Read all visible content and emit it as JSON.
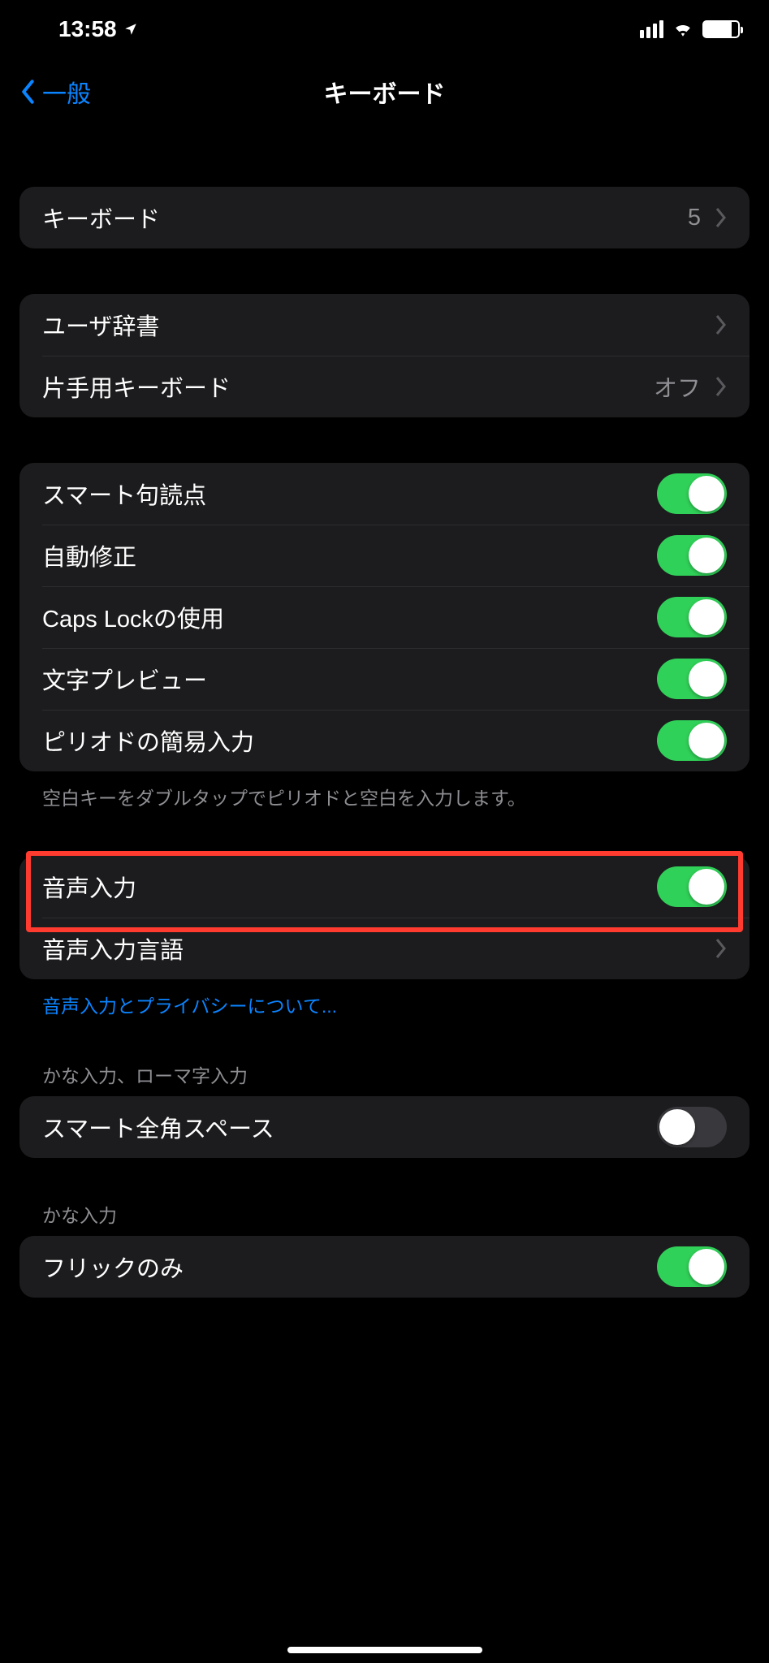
{
  "statusbar": {
    "time": "13:58"
  },
  "nav": {
    "back_label": "一般",
    "title": "キーボード"
  },
  "groups": {
    "g1": {
      "keyboards_label": "キーボード",
      "keyboards_count": "5"
    },
    "g2": {
      "user_dict_label": "ユーザ辞書",
      "one_hand_label": "片手用キーボード",
      "one_hand_value": "オフ"
    },
    "g3": {
      "smart_punct_label": "スマート句読点",
      "auto_correct_label": "自動修正",
      "caps_lock_label": "Caps Lockの使用",
      "char_preview_label": "文字プレビュー",
      "period_shortcut_label": "ピリオドの簡易入力",
      "footer": "空白キーをダブルタップでピリオドと空白を入力します。"
    },
    "g4": {
      "dictation_label": "音声入力",
      "dictation_lang_label": "音声入力言語",
      "footer_link": "音声入力とプライバシーについて..."
    },
    "g5": {
      "header": "かな入力、ローマ字入力",
      "smart_fullwidth_space_label": "スマート全角スペース"
    },
    "g6": {
      "header": "かな入力",
      "flick_only_label": "フリックのみ"
    }
  }
}
